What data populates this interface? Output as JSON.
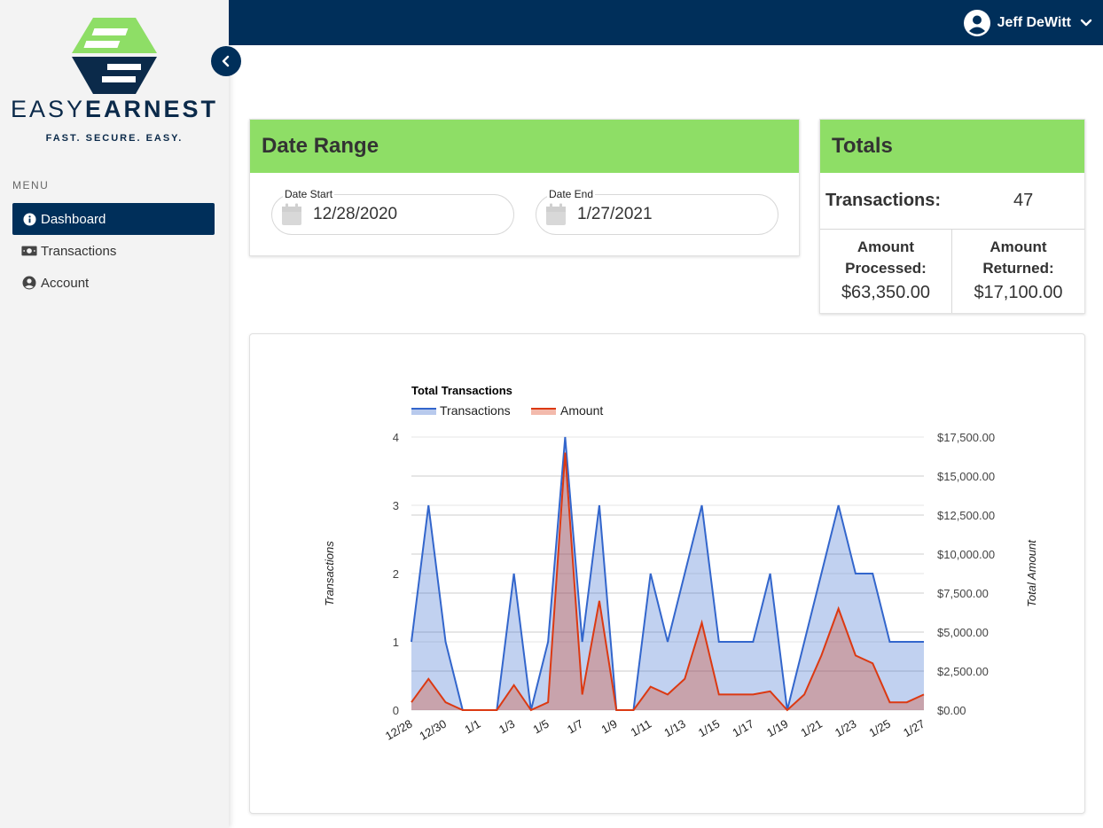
{
  "brand": {
    "name_part1": "EASY",
    "name_part2": "EARNEST",
    "tagline": "FAST. SECURE. EASY.",
    "colors": {
      "green": "#8ede66",
      "navy": "#002f5a"
    }
  },
  "sidebar": {
    "menu_heading": "MENU",
    "items": [
      {
        "label": "Dashboard",
        "icon": "info-icon",
        "active": true
      },
      {
        "label": "Transactions",
        "icon": "money-icon",
        "active": false
      },
      {
        "label": "Account",
        "icon": "user-circle-icon",
        "active": false
      }
    ]
  },
  "header": {
    "user_name": "Jeff DeWitt"
  },
  "date_range": {
    "title": "Date Range",
    "start_label": "Date Start",
    "start_value": "12/28/2020",
    "end_label": "Date End",
    "end_value": "1/27/2021"
  },
  "totals": {
    "title": "Totals",
    "transactions_label": "Transactions:",
    "transactions_value": "47",
    "processed_label": "Amount Processed:",
    "processed_value": "$63,350.00",
    "returned_label": "Amount Returned:",
    "returned_value": "$17,100.00"
  },
  "chart_data": {
    "type": "area",
    "title": "Total Transactions",
    "x": [
      "12/28",
      "12/29",
      "12/30",
      "12/31",
      "1/1",
      "1/2",
      "1/3",
      "1/4",
      "1/5",
      "1/6",
      "1/7",
      "1/8",
      "1/9",
      "1/10",
      "1/11",
      "1/12",
      "1/13",
      "1/14",
      "1/15",
      "1/16",
      "1/17",
      "1/18",
      "1/19",
      "1/20",
      "1/21",
      "1/22",
      "1/23",
      "1/24",
      "1/25",
      "1/26",
      "1/27"
    ],
    "x_tick_labels": [
      "12/28",
      "12/30",
      "1/1",
      "1/3",
      "1/5",
      "1/7",
      "1/9",
      "1/11",
      "1/13",
      "1/15",
      "1/17",
      "1/19",
      "1/21",
      "1/23",
      "1/25",
      "1/27"
    ],
    "series": [
      {
        "name": "Transactions",
        "axis": "left",
        "color": "#3366cc",
        "values": [
          1,
          3,
          1,
          0,
          0,
          0,
          2,
          0,
          1,
          4,
          1,
          3,
          0,
          0,
          2,
          1,
          2,
          3,
          1,
          1,
          1,
          2,
          0,
          1,
          2,
          3,
          2,
          2,
          1,
          1,
          1
        ]
      },
      {
        "name": "Amount",
        "axis": "right",
        "color": "#dc3912",
        "values": [
          500,
          2000,
          500,
          0,
          0,
          0,
          1600,
          0,
          500,
          16500,
          1000,
          7000,
          0,
          0,
          1500,
          1000,
          2000,
          5600,
          1000,
          1000,
          1000,
          1200,
          0,
          1000,
          3500,
          6500,
          3500,
          3000,
          500,
          500,
          1000
        ]
      }
    ],
    "ylabel_left": "Transactions",
    "ylabel_right": "Total Amount",
    "ylim_left": [
      0,
      4
    ],
    "ylim_right": [
      0,
      17500
    ],
    "yticks_left": [
      "0",
      "1",
      "2",
      "3",
      "4"
    ],
    "yticks_right": [
      "$0.00",
      "$2,500.00",
      "$5,000.00",
      "$7,500.00",
      "$10,000.00",
      "$12,500.00",
      "$15,000.00",
      "$17,500.00"
    ],
    "legend": "top-left",
    "grid": true
  }
}
